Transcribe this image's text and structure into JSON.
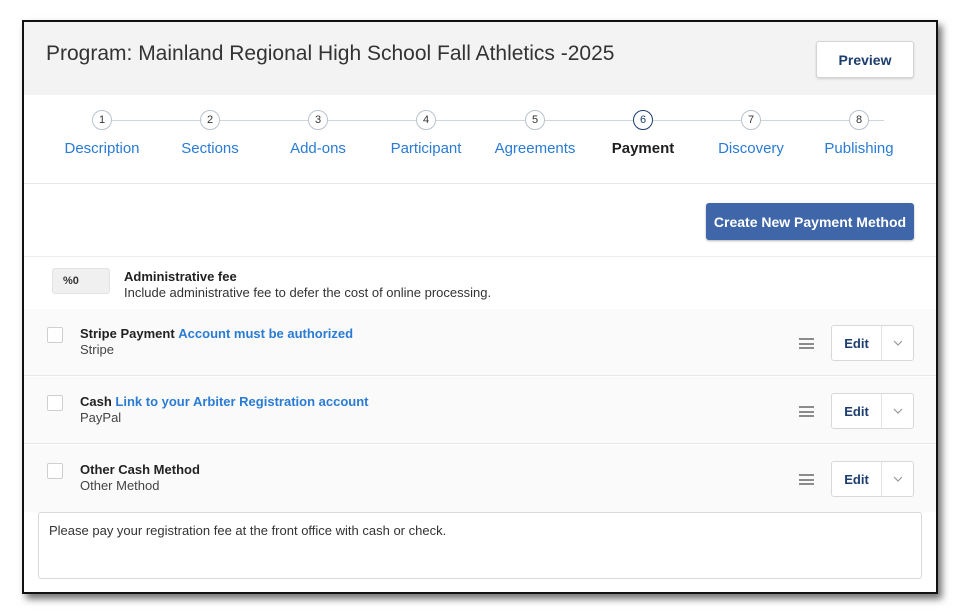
{
  "header": {
    "title": "Program: Mainland Regional High School Fall Athletics -2025",
    "preview_label": "Preview"
  },
  "steps": [
    {
      "number": "1",
      "label": "Description"
    },
    {
      "number": "2",
      "label": "Sections"
    },
    {
      "number": "3",
      "label": "Add-ons"
    },
    {
      "number": "4",
      "label": "Participant"
    },
    {
      "number": "5",
      "label": "Agreements"
    },
    {
      "number": "6",
      "label": "Payment",
      "active": true
    },
    {
      "number": "7",
      "label": "Discovery"
    },
    {
      "number": "8",
      "label": "Publishing"
    }
  ],
  "actions": {
    "create_label": "Create New Payment Method"
  },
  "admin_fee": {
    "badge": "%0",
    "title": "Administrative fee",
    "description": "Include administrative fee to defer the cost of online processing."
  },
  "methods": [
    {
      "name": "Stripe Payment",
      "link": "Account must be authorized",
      "subtitle": "Stripe",
      "edit_label": "Edit"
    },
    {
      "name": "Cash",
      "link": "Link to your Arbiter Registration account",
      "subtitle": "PayPal",
      "edit_label": "Edit"
    },
    {
      "name": "Other Cash Method",
      "link": "",
      "subtitle": "Other Method",
      "edit_label": "Edit"
    }
  ],
  "note": {
    "text": "Please pay your registration fee at the front office with cash or check."
  },
  "colors": {
    "accent": "#3f66a8",
    "link": "#2a7bd4",
    "active_step": "#1c3d6e"
  }
}
